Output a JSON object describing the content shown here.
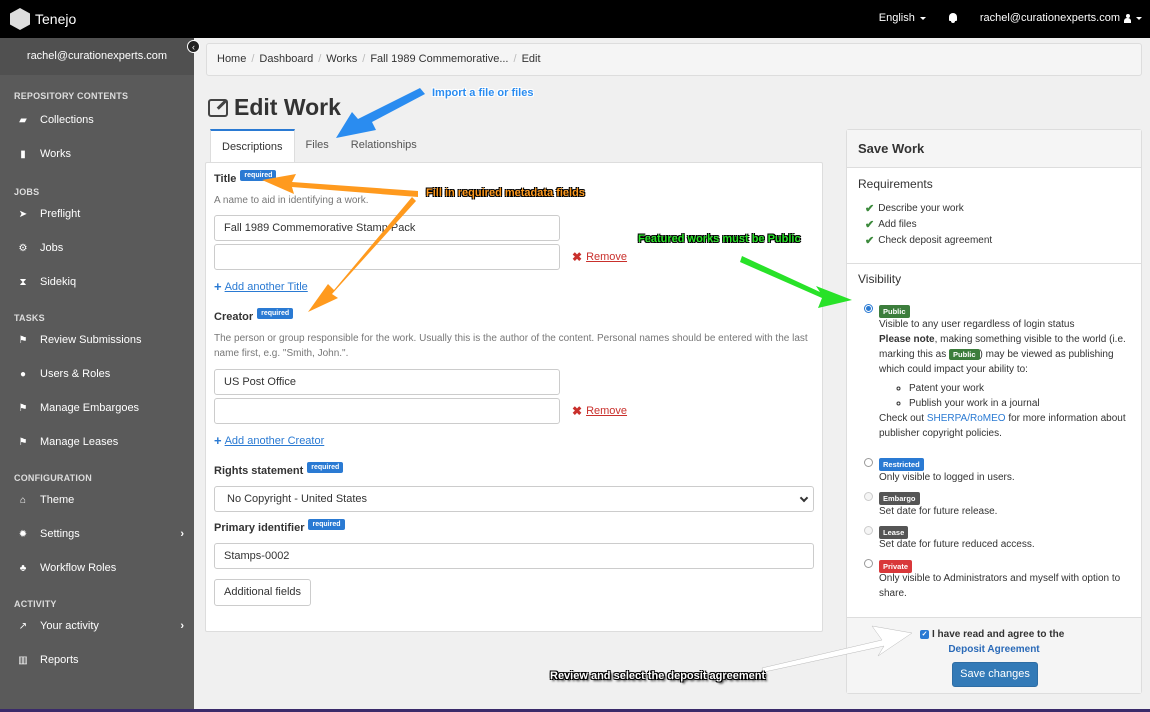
{
  "topbar": {
    "brand": "Tenejo",
    "language": "English",
    "notifications_icon": "bell-icon",
    "user": "rachel@curationexperts.com"
  },
  "sidebar": {
    "user": "rachel@curationexperts.com",
    "sections": [
      {
        "title": "REPOSITORY CONTENTS",
        "items": [
          {
            "label": "Collections",
            "icon": "folder-open-icon"
          },
          {
            "label": "Works",
            "icon": "file-icon"
          }
        ]
      },
      {
        "title": "JOBS",
        "items": [
          {
            "label": "Preflight",
            "icon": "send-icon"
          },
          {
            "label": "Jobs",
            "icon": "cogs-icon"
          },
          {
            "label": "Sidekiq",
            "icon": "hourglass-icon"
          }
        ]
      },
      {
        "title": "TASKS",
        "items": [
          {
            "label": "Review Submissions",
            "icon": "flag-icon"
          },
          {
            "label": "Users & Roles",
            "icon": "user-icon"
          },
          {
            "label": "Manage Embargoes",
            "icon": "flag-icon"
          },
          {
            "label": "Manage Leases",
            "icon": "flag-icon"
          }
        ]
      },
      {
        "title": "CONFIGURATION",
        "items": [
          {
            "label": "Theme",
            "icon": "institution-icon"
          },
          {
            "label": "Settings",
            "icon": "gear-icon",
            "expandable": true
          },
          {
            "label": "Workflow Roles",
            "icon": "users-icon"
          }
        ]
      },
      {
        "title": "ACTIVITY",
        "items": [
          {
            "label": "Your activity",
            "icon": "line-chart-icon",
            "expandable": true
          },
          {
            "label": "Reports",
            "icon": "bar-chart-icon"
          }
        ]
      }
    ]
  },
  "breadcrumb": [
    "Home",
    "Dashboard",
    "Works",
    "Fall 1989 Commemorative...",
    "Edit"
  ],
  "page": {
    "title": "Edit Work",
    "tabs": [
      "Descriptions",
      "Files",
      "Relationships"
    ],
    "active_tab": "Descriptions"
  },
  "form": {
    "required_badge": "required",
    "title": {
      "label": "Title",
      "help": "A name to aid in identifying a work.",
      "values": [
        "Fall 1989 Commemorative Stamp Pack",
        ""
      ],
      "remove": "Remove",
      "add": "Add another Title"
    },
    "creator": {
      "label": "Creator",
      "help": "The person or group responsible for the work. Usually this is the author of the content. Personal names should be entered with the last name first, e.g. \"Smith, John.\".",
      "values": [
        "US Post Office",
        ""
      ],
      "remove": "Remove",
      "add": "Add another Creator"
    },
    "rights": {
      "label": "Rights statement",
      "selected": "No Copyright - United States"
    },
    "identifier": {
      "label": "Primary identifier",
      "value": "Stamps-0002"
    },
    "additional_fields": "Additional fields"
  },
  "save_panel": {
    "title": "Save Work",
    "requirements_title": "Requirements",
    "requirements": [
      "Describe your work",
      "Add files",
      "Check deposit agreement"
    ],
    "visibility_title": "Visibility",
    "options": [
      {
        "badge": "Public",
        "color": "#3c7d3c",
        "checked": true,
        "desc": "Visible to any user regardless of login status"
      },
      {
        "badge": "Restricted",
        "color": "#2a7ad3",
        "checked": false,
        "desc": "Only visible to logged in users."
      },
      {
        "badge": "Embargo",
        "color": "#555555",
        "checked": false,
        "disabled": true,
        "desc": "Set date for future release."
      },
      {
        "badge": "Lease",
        "color": "#555555",
        "checked": false,
        "disabled": true,
        "desc": "Set date for future reduced access."
      },
      {
        "badge": "Private",
        "color": "#d9383a",
        "checked": false,
        "desc": "Only visible to Administrators and myself with option to share."
      }
    ],
    "public_note": {
      "bold": "Please note",
      "text1": ", making something visible to the world (i.e. marking this as ",
      "badge": "Public",
      "text2": ") may be viewed as publishing which could impact your ability to:",
      "bullets": [
        "Patent your work",
        "Publish your work in a journal"
      ],
      "check_prefix": "Check out ",
      "link": "SHERPA/RoMEO",
      "check_suffix": " for more information about publisher copyright policies."
    },
    "agreement_checked": true,
    "agreement_text": "I have read and agree to the",
    "agreement_link": "Deposit Agreement",
    "save_button": "Save changes"
  },
  "annotations": {
    "import": "Import a file or files",
    "metadata": "Fill in required metadata fields",
    "featured": "Featured works must be Public",
    "deposit": "Review and select the deposit agreement"
  }
}
